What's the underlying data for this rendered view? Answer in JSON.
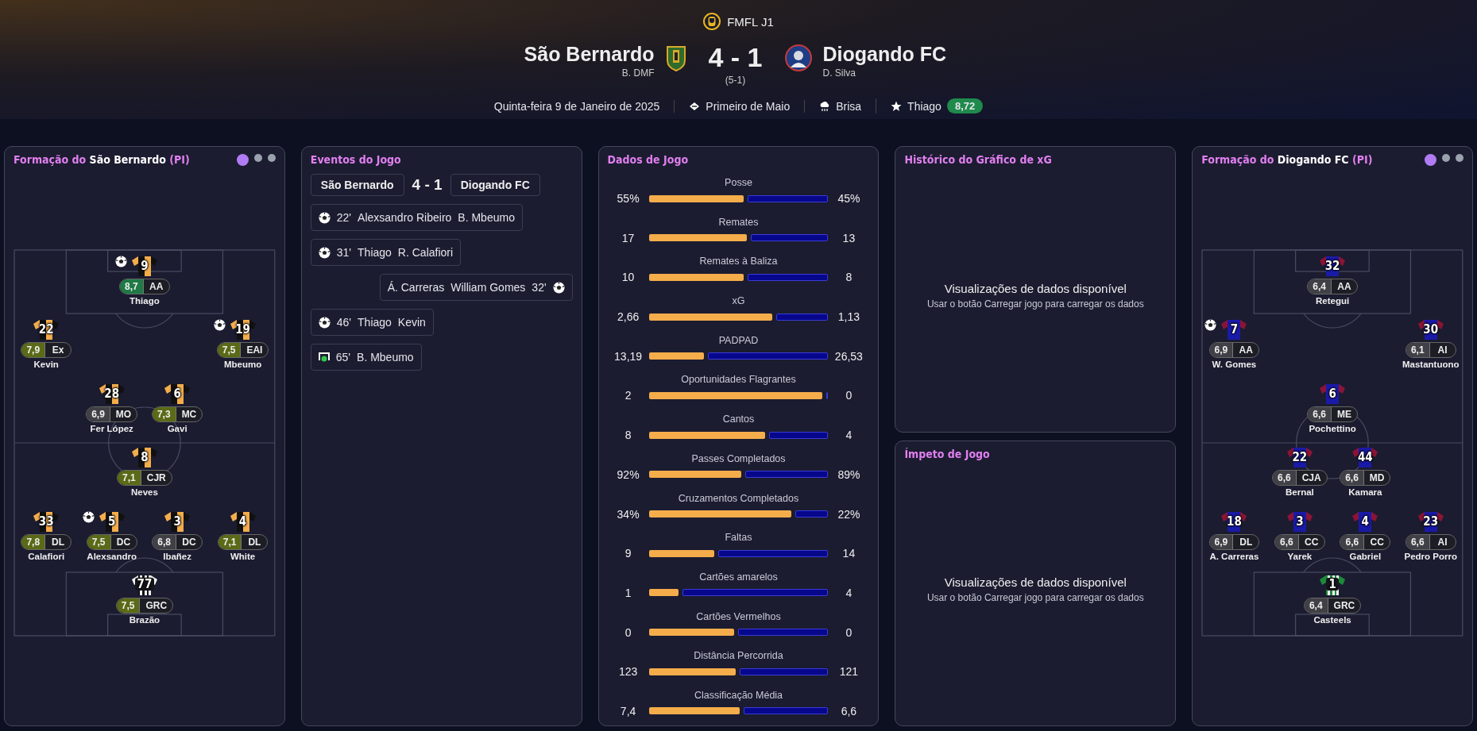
{
  "header": {
    "competition": "FMFL J1",
    "home": {
      "name": "São Bernardo",
      "manager": "B. DMF"
    },
    "score": "4 - 1",
    "aggregate": "(5-1)",
    "away": {
      "name": "Diogando FC",
      "manager": "D. Silva"
    },
    "date": "Quinta-feira 9 de Janeiro de 2025",
    "venue": "Primeiro de Maio",
    "weather": "Brisa",
    "best_player": {
      "name": "Thiago",
      "rating": "8,72"
    }
  },
  "home_lineup": {
    "title": {
      "prefix": "Formação do",
      "team": "São Bernardo",
      "suffix": "(PI)"
    },
    "pages": [
      {
        "selected": true
      },
      {
        "selected": false
      },
      {
        "selected": false
      }
    ],
    "kind": "orange-black",
    "rows": [
      {
        "kind": "centre",
        "players": [
          {
            "kind": "outfield",
            "number": "9",
            "rating": "8,7",
            "color": "#1f7a45",
            "position": "AA",
            "name": "Thiago",
            "goal": true
          }
        ]
      },
      {
        "kind": "flanks",
        "players": [
          {
            "kind": "outfield",
            "number": "22",
            "rating": "7,9",
            "color": "#5b6a17",
            "position": "Ex",
            "name": "Kevin",
            "goal": false
          },
          {
            "kind": "outfield",
            "number": "19",
            "rating": "7,5",
            "color": "#5b6a17",
            "position": "EAI",
            "name": "Mbeumo",
            "goal": true
          }
        ]
      },
      {
        "kind": "inside",
        "players": [
          {
            "kind": "outfield",
            "number": "28",
            "rating": "6,9",
            "color": "#404046",
            "position": "MO",
            "name": "Fer López",
            "goal": false
          },
          {
            "kind": "outfield",
            "number": "6",
            "rating": "7,3",
            "color": "#5b6a17",
            "position": "MC",
            "name": "Gavi",
            "goal": false
          }
        ]
      },
      {
        "kind": "centre",
        "players": [
          {
            "kind": "outfield",
            "number": "8",
            "rating": "7,1",
            "color": "#5b6a17",
            "position": "CJR",
            "name": "Neves",
            "goal": false
          }
        ]
      },
      {
        "kind": "line",
        "players": [
          {
            "kind": "outfield",
            "number": "33",
            "rating": "7,8",
            "color": "#5b6a17",
            "position": "DL",
            "name": "Calafiori",
            "goal": false
          },
          {
            "kind": "outfield",
            "number": "5",
            "rating": "7,5",
            "color": "#5b6a17",
            "position": "DC",
            "name": "Alexsandro",
            "goal": true
          },
          {
            "kind": "outfield",
            "number": "3",
            "rating": "6,8",
            "color": "#404046",
            "position": "DC",
            "name": "Ibañez",
            "goal": false
          },
          {
            "kind": "outfield",
            "number": "4",
            "rating": "7,1",
            "color": "#5b6a17",
            "position": "DL",
            "name": "White",
            "goal": false
          }
        ]
      },
      {
        "kind": "centre",
        "players": [
          {
            "kind": "keeper",
            "number": "77",
            "rating": "7,5",
            "color": "#5b6a17",
            "position": "GRC",
            "name": "Brazão",
            "goal": false
          }
        ]
      }
    ]
  },
  "events": {
    "title": "Eventos do Jogo",
    "home": "São Bernardo",
    "score": "4 - 1",
    "away": "Diogando FC",
    "items": [
      {
        "away": false,
        "kind": "goal",
        "minute": "22'",
        "player": "Alexsandro Ribeiro",
        "assist": "B. Mbeumo"
      },
      {
        "away": false,
        "kind": "goal",
        "minute": "31'",
        "player": "Thiago",
        "assist": "R. Calafiori"
      },
      {
        "away": true,
        "kind": "goal",
        "minute": "32'",
        "player": "William Gomes",
        "assist": "Á. Carreras"
      },
      {
        "away": false,
        "kind": "goal",
        "minute": "46'",
        "player": "Thiago",
        "assist": "Kevin"
      },
      {
        "away": false,
        "kind": "goal-frame",
        "minute": "65'",
        "player": "B. Mbeumo"
      }
    ]
  },
  "stats": {
    "title": "Dados de Jogo",
    "items": [
      {
        "label": "Posse",
        "home": "55%",
        "away": "45%",
        "level": 0.54
      },
      {
        "label": "Remates",
        "home": "17",
        "away": "13",
        "level": 0.56
      },
      {
        "label": "Remates à Baliza",
        "home": "10",
        "away": "8",
        "level": 0.54
      },
      {
        "label": "xG",
        "home": "2,66",
        "away": "1,13",
        "level": 0.7
      },
      {
        "label": "PADPAD",
        "home": "13,19",
        "away": "26,53",
        "level": 0.32
      },
      {
        "label": "Oportunidades Flagrantes",
        "home": "2",
        "away": "0",
        "level": 0.99
      },
      {
        "label": "Cantos",
        "home": "8",
        "away": "4",
        "level": 0.66
      },
      {
        "label": "Passes Completados",
        "home": "92%",
        "away": "89%",
        "level": 0.53
      },
      {
        "label": "Cruzamentos Completados",
        "home": "34%",
        "away": "22%",
        "level": 0.81
      },
      {
        "label": "Faltas",
        "home": "9",
        "away": "14",
        "level": 0.38
      },
      {
        "label": "Cartões amarelos",
        "home": "1",
        "away": "4",
        "level": 0.18
      },
      {
        "label": "Cartões Vermelhos",
        "home": "0",
        "away": "0",
        "level": 0.49
      },
      {
        "label": "Distância Percorrida",
        "home": "123",
        "away": "121",
        "level": 0.5
      },
      {
        "label": "Classificação Média",
        "home": "7,4",
        "away": "6,6",
        "level": 0.52
      }
    ]
  },
  "xg_history": {
    "title": "Histórico do Gráfico de xG",
    "message": "Visualizações de dados disponível",
    "hint": "Usar o botão Carregar jogo para carregar os dados"
  },
  "momentum": {
    "title": "Ímpeto de Jogo",
    "message": "Visualizações de dados disponível",
    "hint": "Usar o botão Carregar jogo para carregar os dados"
  },
  "away_lineup": {
    "title": {
      "prefix": "Formação do",
      "team": "Diogando FC",
      "suffix": "(PI)"
    },
    "pages": [
      {
        "selected": true
      },
      {
        "selected": false
      },
      {
        "selected": false
      }
    ],
    "kind": "blue-red",
    "rows": [
      {
        "kind": "centre",
        "players": [
          {
            "kind": "outfield",
            "number": "32",
            "rating": "6,4",
            "color": "#404046",
            "position": "AA",
            "name": "Retegui",
            "goal": false
          }
        ]
      },
      {
        "kind": "flanks",
        "players": [
          {
            "kind": "outfield",
            "number": "7",
            "rating": "6,9",
            "color": "#404046",
            "position": "AA",
            "name": "W. Gomes",
            "goal": true
          },
          {
            "kind": "outfield",
            "number": "30",
            "rating": "6,1",
            "color": "#404046",
            "position": "AI",
            "name": "Mastantuono",
            "goal": false
          }
        ]
      },
      {
        "kind": "centre",
        "players": [
          {
            "kind": "outfield",
            "number": "6",
            "rating": "6,6",
            "color": "#404046",
            "position": "ME",
            "name": "Pochettino",
            "goal": false
          }
        ]
      },
      {
        "kind": "inside",
        "players": [
          {
            "kind": "outfield",
            "number": "22",
            "rating": "6,6",
            "color": "#404046",
            "position": "CJA",
            "name": "Bernal",
            "goal": false
          },
          {
            "kind": "outfield",
            "number": "44",
            "rating": "6,6",
            "color": "#404046",
            "position": "MD",
            "name": "Kamara",
            "goal": false
          }
        ]
      },
      {
        "kind": "line",
        "players": [
          {
            "kind": "outfield",
            "number": "18",
            "rating": "6,9",
            "color": "#404046",
            "position": "DL",
            "name": "A. Carreras",
            "goal": false
          },
          {
            "kind": "outfield",
            "number": "3",
            "rating": "6,6",
            "color": "#404046",
            "position": "CC",
            "name": "Yarek",
            "goal": false
          },
          {
            "kind": "outfield",
            "number": "4",
            "rating": "6,6",
            "color": "#404046",
            "position": "CC",
            "name": "Gabriel",
            "goal": false
          },
          {
            "kind": "outfield",
            "number": "23",
            "rating": "6,6",
            "color": "#404046",
            "position": "AI",
            "name": "Pedro Porro",
            "goal": false
          }
        ]
      },
      {
        "kind": "centre",
        "players": [
          {
            "kind": "keeper",
            "number": "1",
            "rating": "6,4",
            "color": "#404046",
            "position": "GRC",
            "name": "Casteels",
            "goal": false
          }
        ]
      }
    ]
  }
}
